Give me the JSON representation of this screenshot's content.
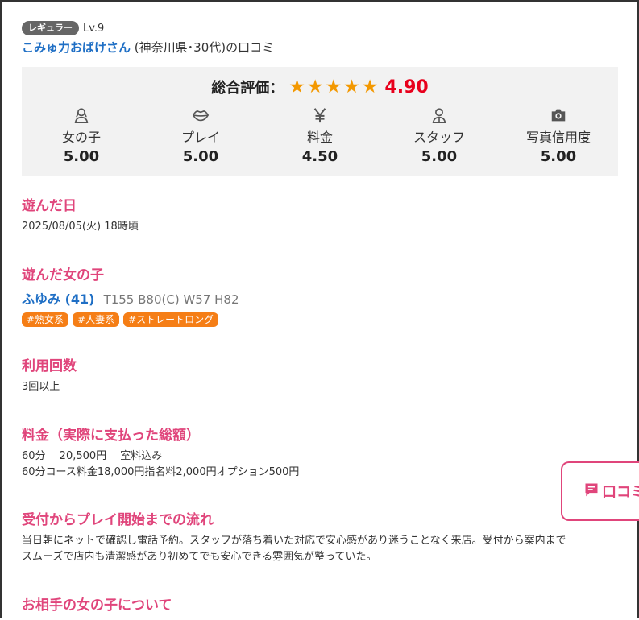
{
  "reviewer": {
    "rank_badge": "レギュラー",
    "level": "Lv.9",
    "name": "こみゅ力おばけさん",
    "meta": "(神奈川県･30代)の口コミ"
  },
  "rating": {
    "overall_label": "総合評価：",
    "stars": "★★★★★",
    "overall_score": "4.90",
    "categories": [
      {
        "icon": "woman-icon",
        "label": "女の子",
        "score": "5.00"
      },
      {
        "icon": "lips-icon",
        "label": "プレイ",
        "score": "5.00"
      },
      {
        "icon": "yen-icon",
        "label": "料金",
        "score": "4.50"
      },
      {
        "icon": "staff-icon",
        "label": "スタッフ",
        "score": "5.00"
      },
      {
        "icon": "camera-icon",
        "label": "写真信用度",
        "score": "5.00"
      }
    ]
  },
  "sections": {
    "visit_date_title": "遊んだ日",
    "visit_date": "2025/08/05(火) 18時頃",
    "girl_title": "遊んだ女の子",
    "girl_name": "ふゆみ (41)",
    "girl_stats": "T155 B80(C) W57 H82",
    "tags": [
      "#熟女系",
      "#人妻系",
      "#ストレートロング"
    ],
    "usage_title": "利用回数",
    "usage": "3回以上",
    "price_title": "料金（実際に支払った総額）",
    "price_line1": "60分　 20,500円　 室料込み",
    "price_line2": "60分コース料金18,000円指名料2,000円オプション500円",
    "flow_title": "受付からプレイ開始までの流れ",
    "flow_line1": "当日朝にネットで確認し電話予約。スタッフが落ち着いた対応で安心感があり迷うことなく来店。受付から案内まで",
    "flow_line2": "スムーズで店内も清潔感があり初めてでも安心できる雰囲気が整っていた。",
    "partner_title": "お相手の女の子について"
  },
  "float_button": {
    "icon": "comment-icon",
    "label": "口コミ"
  },
  "colors": {
    "accent_pink": "#e0457b",
    "link_blue": "#1f6fc5",
    "star_orange": "#f39800",
    "score_red": "#e8001c",
    "tag_orange": "#f57e16"
  }
}
